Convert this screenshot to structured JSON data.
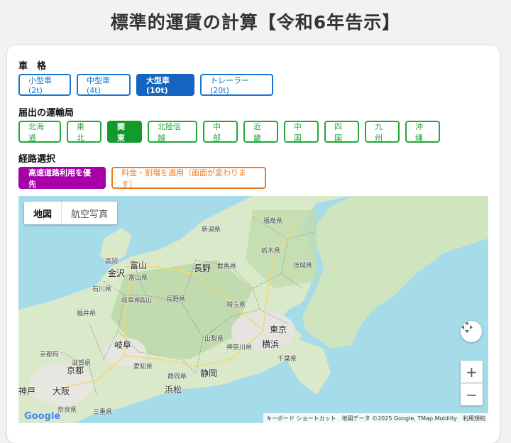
{
  "title": "標準的運賃の計算【令和6年告示】",
  "vehicle": {
    "label": "車　格",
    "options": [
      "小型車(2t)",
      "中型車(4t)",
      "大型車(10t)",
      "トレーラー(20t)"
    ],
    "selected_index": 2
  },
  "bureau": {
    "label": "届出の運輸局",
    "options": [
      "北海道",
      "東北",
      "関東",
      "北陸信越",
      "中部",
      "近畿",
      "中国",
      "四国",
      "九州",
      "沖縄"
    ],
    "selected_index": 2
  },
  "route": {
    "label": "経路選択",
    "highway_button": "高速道路利用を優先",
    "surcharge_button": "料金・割増を適用（画面が変わります）"
  },
  "map": {
    "type_map": "地図",
    "type_satellite": "航空写真",
    "zoom_in": "+",
    "zoom_out": "−",
    "google_logo": "Google",
    "attribution": {
      "shortcuts": "キーボード ショートカット",
      "data": "地図データ ©2025 Google, TMap Mobility",
      "terms": "利用規約"
    },
    "labels": {
      "fukushima": "福島県",
      "niigata": "新潟県",
      "tochigi": "栃木県",
      "ibaraki": "茨城県",
      "gunma": "群馬県",
      "saitama": "埼玉県",
      "yamanashi": "山梨県",
      "kanagawa": "神奈川県",
      "chiba": "千葉県",
      "nagano_pref": "長野県",
      "toyama_pref": "富山県",
      "ishikawa": "石川県",
      "fukui": "福井県",
      "gifu_pref": "岐阜県",
      "aichi": "愛知県",
      "shizuoka_pref": "静岡県",
      "shiga": "滋賀県",
      "kyoto_pref": "京都府",
      "mie": "三重県",
      "nara": "奈良県",
      "takaoka": "高岡",
      "toyama": "富山",
      "kanazawa": "金沢",
      "nagano": "長野",
      "takayama": "高山",
      "tokyo": "東京",
      "yokohama": "横浜",
      "gifu": "岐阜",
      "shizuoka": "静岡",
      "hamamatsu": "浜松",
      "kyoto": "京都",
      "osaka": "大阪",
      "kobe": "神戸"
    }
  },
  "colors": {
    "blue": "#1976d2",
    "green": "#22a83a",
    "purple": "#a600a6",
    "orange": "#f07a1d"
  }
}
